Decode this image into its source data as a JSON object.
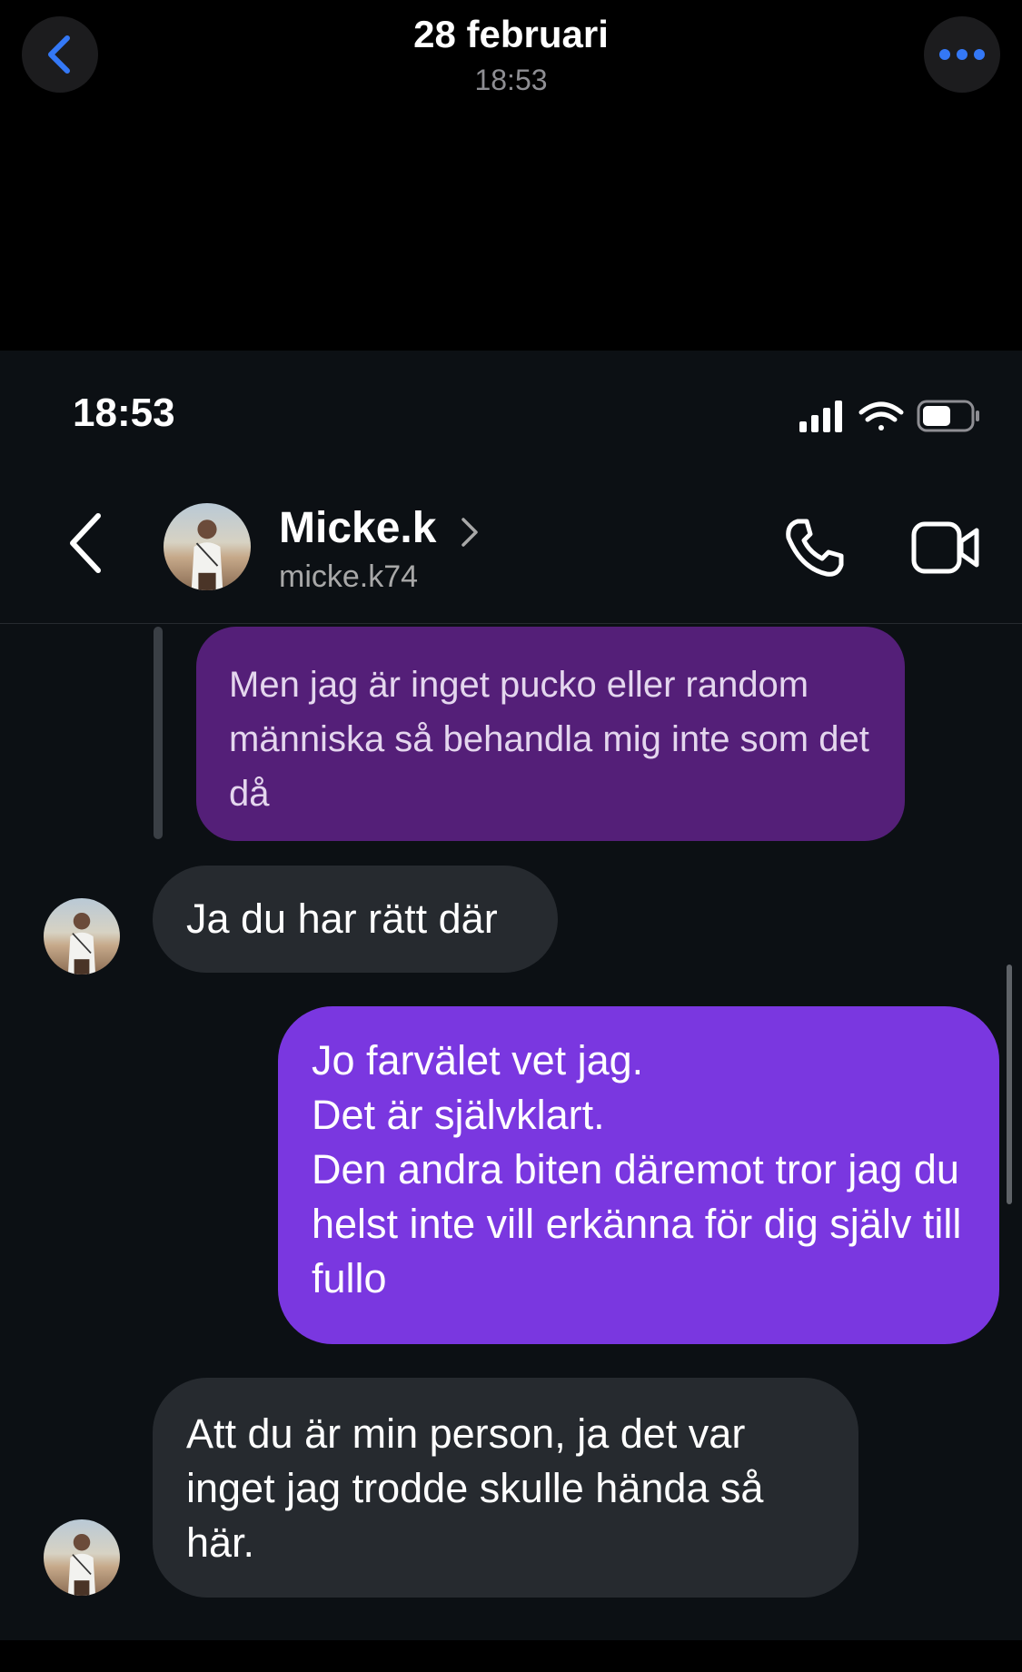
{
  "viewer": {
    "date": "28 februari",
    "time": "18:53",
    "back_icon": "chevron-left-icon",
    "more_icon": "ellipsis-icon",
    "accent": "#3478f6"
  },
  "status_bar": {
    "time": "18:53",
    "icons": [
      "cellular-signal-icon",
      "wifi-icon",
      "battery-icon"
    ]
  },
  "chat_header": {
    "contact_name": "Micke.k",
    "username": "micke.k74",
    "actions": [
      "phone-icon",
      "video-call-icon"
    ]
  },
  "messages": [
    {
      "sender": "me",
      "style": "quoted",
      "text": "Men jag är inget pucko eller random människa så behandla mig inte som det då"
    },
    {
      "sender": "contact",
      "text": "Ja du har rätt där"
    },
    {
      "sender": "me",
      "lines": [
        "Jo farvälet vet jag.",
        "Det är självklart.",
        "Den andra biten däremot tror jag du helst inte vill erkänna för dig själv till fullo"
      ]
    },
    {
      "sender": "contact",
      "text": "Att du är min person, ja det var inget jag trodde skulle hända så här."
    }
  ],
  "colors": {
    "chat_background": "#0c1014",
    "incoming_bubble": "#262a2f",
    "outgoing_bubble": "#7a37e0",
    "quoted_bubble": "#541f78"
  }
}
